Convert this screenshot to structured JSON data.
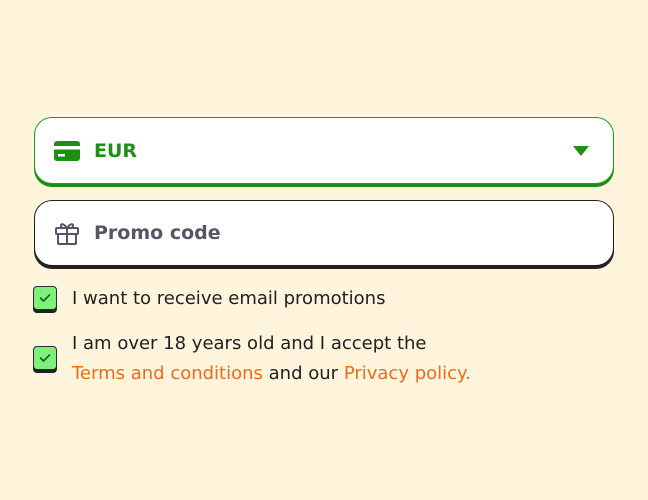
{
  "currency": {
    "value": "EUR",
    "icon": "credit-card-icon",
    "accent_color": "#1f8f13"
  },
  "promo": {
    "placeholder": "Promo code",
    "icon": "gift-icon"
  },
  "checkboxes": [
    {
      "label": "I want to receive email promotions",
      "checked": true
    },
    {
      "line1": "I am over 18 years old and I accept the",
      "terms_link": "Terms and conditions",
      "connector": "and our",
      "privacy_link": "Privacy policy.",
      "checked": true
    }
  ],
  "colors": {
    "background": "#fff5dc",
    "link": "#ec6c18",
    "checkbox_fill": "#7ff07a"
  }
}
